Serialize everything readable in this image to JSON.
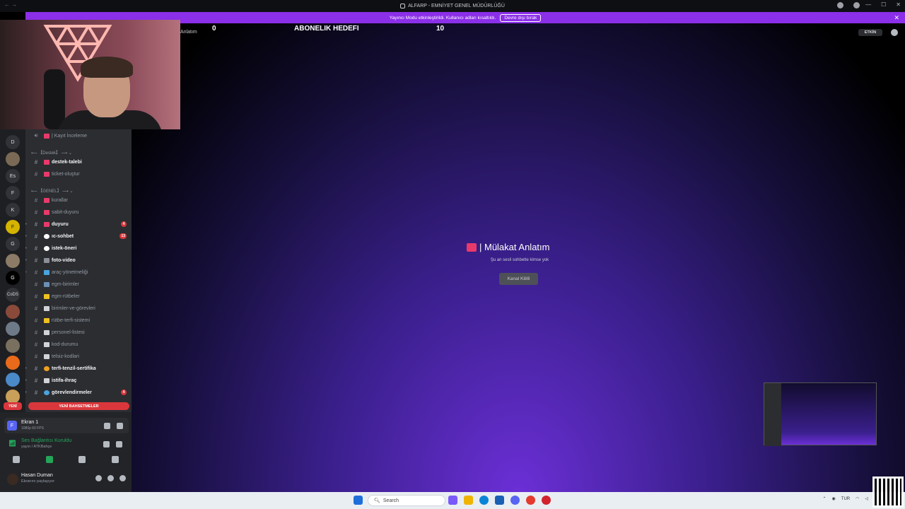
{
  "window": {
    "title": "ALFARP - EMNİYET GENEL MÜDÜRLÜĞÜ"
  },
  "banner": {
    "text": "Yayıncı Modu etkinleştirildi. Kullanıcı adları kısaltıldı.",
    "button": "Devre dışı bırak"
  },
  "overlay": {
    "left_value": "0",
    "title": "ABONELIK HEDEFI",
    "right_value": "10",
    "label": "Anlatım"
  },
  "servers": [
    "D",
    "Es",
    "F",
    "K",
    "G",
    "CoDS"
  ],
  "channels": {
    "top_item": "| Kayıt İnceleme",
    "categories": [
      "【Destek】",
      "【GENEL】"
    ],
    "items": [
      {
        "label": "destek-talebi",
        "bold": true,
        "badge": ""
      },
      {
        "label": "ticket-oluştur",
        "bold": false,
        "badge": ""
      },
      {
        "label": "kurallar",
        "bold": false,
        "badge": ""
      },
      {
        "label": "sabit-duyuru",
        "bold": false,
        "badge": ""
      },
      {
        "label": "duyuru",
        "bold": true,
        "badge": "4"
      },
      {
        "label": "ıc-sohbet",
        "bold": true,
        "badge": "13"
      },
      {
        "label": "istek-öneri",
        "bold": true,
        "badge": ""
      },
      {
        "label": "foto-video",
        "bold": true,
        "badge": ""
      },
      {
        "label": "araç-yönetmeliği",
        "bold": false,
        "badge": ""
      },
      {
        "label": "egm-birimler",
        "bold": false,
        "badge": ""
      },
      {
        "label": "egm-rütbeler",
        "bold": false,
        "badge": ""
      },
      {
        "label": "birimler-ve-görevleri",
        "bold": false,
        "badge": ""
      },
      {
        "label": "rütbe-terfi-sistemi",
        "bold": false,
        "badge": ""
      },
      {
        "label": "personel-listesi",
        "bold": false,
        "badge": ""
      },
      {
        "label": "kod-durumu",
        "bold": false,
        "badge": ""
      },
      {
        "label": "telsiz-kodlari",
        "bold": false,
        "badge": ""
      },
      {
        "label": "terfi-tenzil-sertifika",
        "bold": true,
        "badge": ""
      },
      {
        "label": "istifa-ihraç",
        "bold": true,
        "badge": ""
      },
      {
        "label": "görevlendirmeler",
        "bold": true,
        "badge": "4"
      }
    ],
    "mentions_button": "YENİ BAHSETMELER",
    "new_badge": "YENİ"
  },
  "stream": {
    "name": "Ekran 1",
    "quality": "1080p 60 FPS",
    "initial": "F"
  },
  "voice": {
    "status": "Ses Bağlantısı Kuruldu",
    "channel": "yayın / ATKBahçe"
  },
  "user": {
    "name": "Hasan Duman",
    "status": "Ekranını paylaşıyor"
  },
  "main": {
    "channel_title": "| Mülakat Anlatım",
    "subtitle": "Şu an sesli sohbette kimse yok",
    "locked_button": "Kanal Kilitli",
    "active_badge": "ETKİN"
  },
  "taskbar": {
    "search_placeholder": "Search",
    "lang": "TUR"
  },
  "colors": {
    "accent_purple": "#8b2fe8",
    "mention_red": "#da373c",
    "voice_green": "#23a55a"
  }
}
